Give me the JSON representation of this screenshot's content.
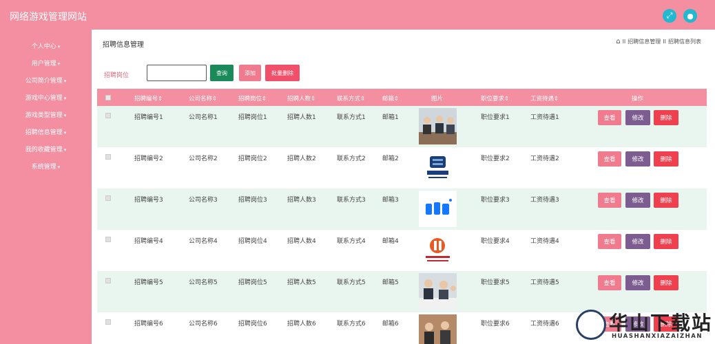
{
  "header": {
    "title": "网络游戏管理网站"
  },
  "sidebar": {
    "items": [
      {
        "label": "个人中心"
      },
      {
        "label": "用户管理"
      },
      {
        "label": "公司简介管理"
      },
      {
        "label": "游戏中心管理"
      },
      {
        "label": "游戏类型管理"
      },
      {
        "label": "招聘信息管理"
      },
      {
        "label": "我的收藏管理"
      },
      {
        "label": "系统管理"
      }
    ]
  },
  "page": {
    "title": "招聘信息管理",
    "breadcrumb": [
      "招聘信息管理",
      "招聘信息列表"
    ],
    "breadcrumb_sep": "II"
  },
  "search": {
    "label": "招聘岗位",
    "value": "",
    "placeholder": ""
  },
  "toolbar": {
    "query": "查询",
    "add": "添加",
    "batch_delete": "批量删除"
  },
  "table": {
    "columns": [
      "招聘编号",
      "公司名称",
      "招聘岗位",
      "招聘人数",
      "联系方式",
      "邮箱",
      "图片",
      "职位要求",
      "工资待遇",
      "操作"
    ],
    "sortable_mark": "⇕",
    "rows": [
      {
        "id": "招聘编号1",
        "company": "公司名称1",
        "position": "招聘岗位1",
        "count": "招聘人数1",
        "contact": "联系方式1",
        "email": "邮箱1",
        "image": "meeting-photo",
        "requirement": "职位要求1",
        "salary": "工资待遇1"
      },
      {
        "id": "招聘编号2",
        "company": "公司名称2",
        "position": "招聘岗位2",
        "count": "招聘人数2",
        "contact": "联系方式2",
        "email": "邮箱2",
        "image": "geely-logo",
        "requirement": "职位要求2",
        "salary": "工资待遇2"
      },
      {
        "id": "招聘编号3",
        "company": "公司名称3",
        "position": "招聘岗位3",
        "count": "招聘人数3",
        "contact": "联系方式3",
        "email": "邮箱3",
        "image": "alipay-logo",
        "requirement": "职位要求3",
        "salary": "工资待遇3"
      },
      {
        "id": "招聘编号4",
        "company": "公司名称4",
        "position": "招聘岗位4",
        "count": "招聘人数4",
        "contact": "联系方式4",
        "email": "邮箱4",
        "image": "company-logo",
        "requirement": "职位要求4",
        "salary": "工资待遇4"
      },
      {
        "id": "招聘编号5",
        "company": "公司名称5",
        "position": "招聘岗位5",
        "count": "招聘人数5",
        "contact": "联系方式5",
        "email": "邮箱5",
        "image": "meeting-photo",
        "requirement": "职位要求5",
        "salary": "工资待遇5"
      },
      {
        "id": "招聘编号6",
        "company": "公司名称6",
        "position": "招聘岗位6",
        "count": "招聘人数6",
        "contact": "联系方式6",
        "email": "邮箱6",
        "image": "office-photo",
        "requirement": "职位要求6",
        "salary": "工资待遇6"
      }
    ],
    "actions": {
      "view": "查看",
      "edit": "修改",
      "delete": "删除"
    }
  },
  "watermark": {
    "title": "华山下载站",
    "subtitle": "HUASHANXIAZAIZHAN"
  },
  "icons": {
    "fullscreen": "expand-icon",
    "user": "user-icon",
    "home": "home-icon",
    "caret": "caret-down-icon"
  },
  "colors": {
    "primary_pink": "#f48fa2",
    "query_green": "#1a8a5a",
    "delete_red": "#f0404f",
    "edit_purple": "#7d5d8f",
    "row_tint": "#e9f5ef"
  }
}
